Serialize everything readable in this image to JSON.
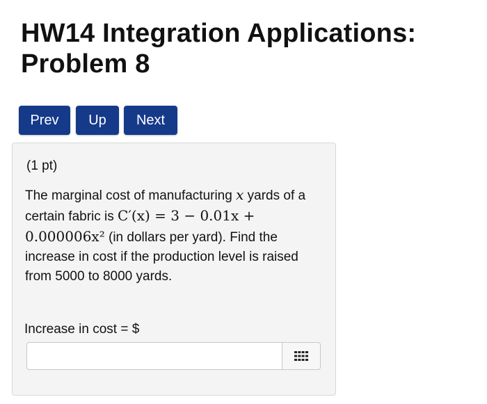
{
  "header": {
    "title_line1": "HW14 Integration Applications:",
    "title_line2": "Problem 8"
  },
  "nav": {
    "prev_label": "Prev",
    "up_label": "Up",
    "next_label": "Next"
  },
  "problem": {
    "points": "(1 pt)",
    "text_part1": "The marginal cost of manufacturing ",
    "var_x": "x",
    "text_part2": " yards of a certain fabric is ",
    "equation": "C′(x) = 3 − 0.01x + 0.000006x²",
    "text_part3": " (in dollars per yard). Find the increase in cost if the production level is raised from 5000 to 8000 yards."
  },
  "answer": {
    "label": "Increase in cost = $",
    "value": "",
    "keypad_icon": "keypad-grid-icon"
  },
  "colors": {
    "nav_button_bg": "#163a8a",
    "problem_box_bg": "#f4f4f4"
  }
}
